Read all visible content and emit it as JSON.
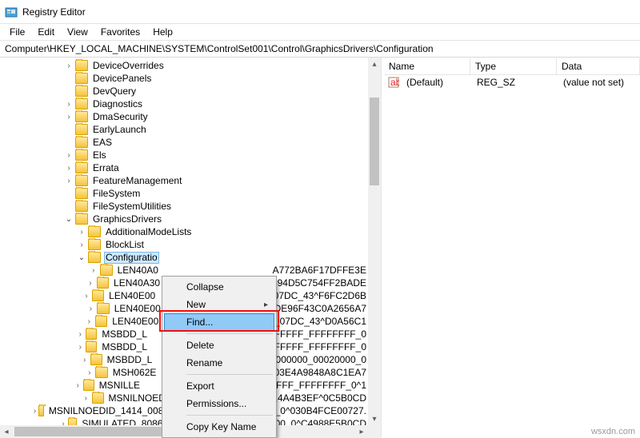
{
  "window": {
    "title": "Registry Editor"
  },
  "menus": {
    "file": "File",
    "edit": "Edit",
    "view": "View",
    "favorites": "Favorites",
    "help": "Help"
  },
  "address": "Computer\\HKEY_LOCAL_MACHINE\\SYSTEM\\ControlSet001\\Control\\GraphicsDrivers\\Configuration",
  "tree": {
    "a": "DeviceOverrides",
    "b": "DevicePanels",
    "c": "DevQuery",
    "d": "Diagnostics",
    "e": "DmaSecurity",
    "f": "EarlyLaunch",
    "g": "EAS",
    "h": "Els",
    "i": "Errata",
    "j": "FeatureManagement",
    "k": "FileSystem",
    "l": "FileSystemUtilities",
    "m": "GraphicsDrivers",
    "n": "AdditionalModeLists",
    "o": "BlockList",
    "p": "Configuratio",
    "q1": "LEN40A0",
    "q2": "LEN40A30",
    "q3": "LEN40E00",
    "q4": "LEN40E00",
    "q5": "LEN40E00",
    "q6": "MSBDD_L",
    "q7": "MSBDD_L",
    "q8": "MSBDD_L",
    "q9": "MSH062E",
    "q10": "MSNILLE",
    "q11": "MSNILNOEDID_03_07DC_30_07DD_14A4B3EF^0C5B0CD",
    "q12": "MSNILNOEDID_1414_008D_FFFFFFFF_FFFFFFFF_0^030B4FCE00727.",
    "q13": "SIMULATED_8086_1616_00000000_00020000_0^C4988E5B0CD",
    "r1": "A772BA6F17DFFE3E",
    "r2": "7394D5C754FF2BADE",
    "r3": "01_07DC_43^F6FC2D6B",
    "r4": "BDE96F43C0A2656A7",
    "r5": "01_07DC_43^D0A56C1",
    "r6": "D_FFFFFFFF_FFFFFFFF_0",
    "r7": "D_FFFFFFFF_FFFFFFFF_0",
    "r8": "6_00000000_00020000_0",
    "r9": "5803E4A9848A8C1EA7",
    "r10": "F_FFFFFFFF_FFFFFFFF_0^1"
  },
  "values_header": {
    "name": "Name",
    "type": "Type",
    "data": "Data"
  },
  "value_row": {
    "name": "(Default)",
    "type": "REG_SZ",
    "data": "(value not set)"
  },
  "ctx": {
    "collapse": "Collapse",
    "new": "New",
    "find": "Find...",
    "delete": "Delete",
    "rename": "Rename",
    "export": "Export",
    "permissions": "Permissions...",
    "copykey": "Copy Key Name"
  },
  "watermark": "wsxdn.com"
}
